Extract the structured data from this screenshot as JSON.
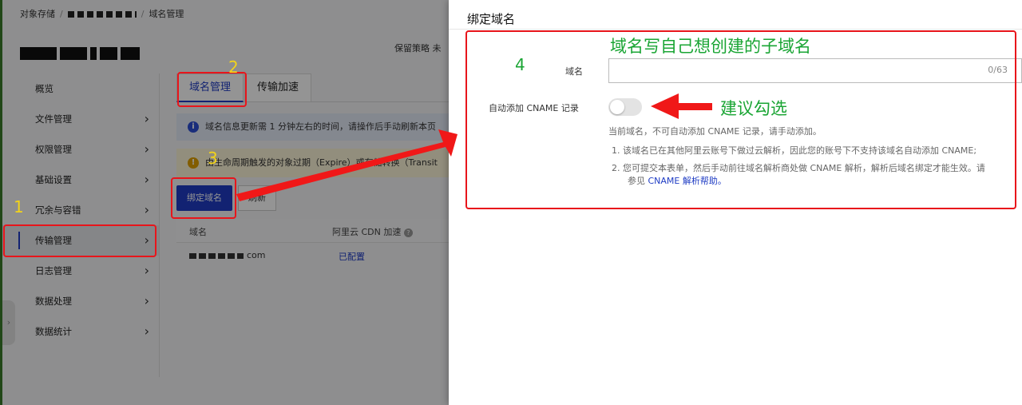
{
  "breadcrumb": {
    "root": "对象存储",
    "current": "域名管理"
  },
  "bucket": {
    "retention_label": "保留策略  未"
  },
  "sidebar": {
    "items": [
      {
        "label": "概览"
      },
      {
        "label": "文件管理"
      },
      {
        "label": "权限管理"
      },
      {
        "label": "基础设置"
      },
      {
        "label": "冗余与容错"
      },
      {
        "label": "传输管理"
      },
      {
        "label": "日志管理"
      },
      {
        "label": "数据处理"
      },
      {
        "label": "数据统计"
      }
    ]
  },
  "tabs": [
    {
      "label": "域名管理"
    },
    {
      "label": "传输加速"
    }
  ],
  "info_bar": {
    "text": "域名信息更新需 1 分钟左右的时间，请操作后手动刷新本页"
  },
  "warn_bar": {
    "text": "由生命周期触发的对象过期（Expire）或存储转换（Transit"
  },
  "toolbar": {
    "bind_label": "绑定域名",
    "refresh_label": "刷新"
  },
  "table": {
    "columns": [
      "域名",
      "阿里云 CDN 加速"
    ],
    "rows": [
      {
        "domain_suffix": "com",
        "status": "已配置"
      }
    ]
  },
  "drawer": {
    "title": "绑定域名",
    "domain_label": "域名",
    "domain_value": "",
    "domain_counter": "0/63",
    "cname_label": "自动添加 CNAME 记录",
    "cname_enabled": false,
    "hint": "当前域名，不可自动添加 CNAME 记录，请手动添加。",
    "note1": "1.  该域名已在其他阿里云账号下做过云解析，因此您的账号下不支持该域名自动添加 CNAME;",
    "note2": "2.  您可提交本表单，然后手动前往域名解析商处做 CNAME 解析，解析后域名绑定才能生效。请",
    "note3_prefix": "参见 ",
    "note3_link": "CNAME 解析帮助。"
  },
  "annotations": {
    "step1": "1",
    "step2": "2",
    "step3": "3",
    "step4": "4",
    "callout_domain": "域名写自己想创建的子域名",
    "callout_toggle": "建议勾选",
    "color_box": "#e8151b",
    "color_step": "#f2d31a",
    "color_callout": "#1aa534"
  }
}
